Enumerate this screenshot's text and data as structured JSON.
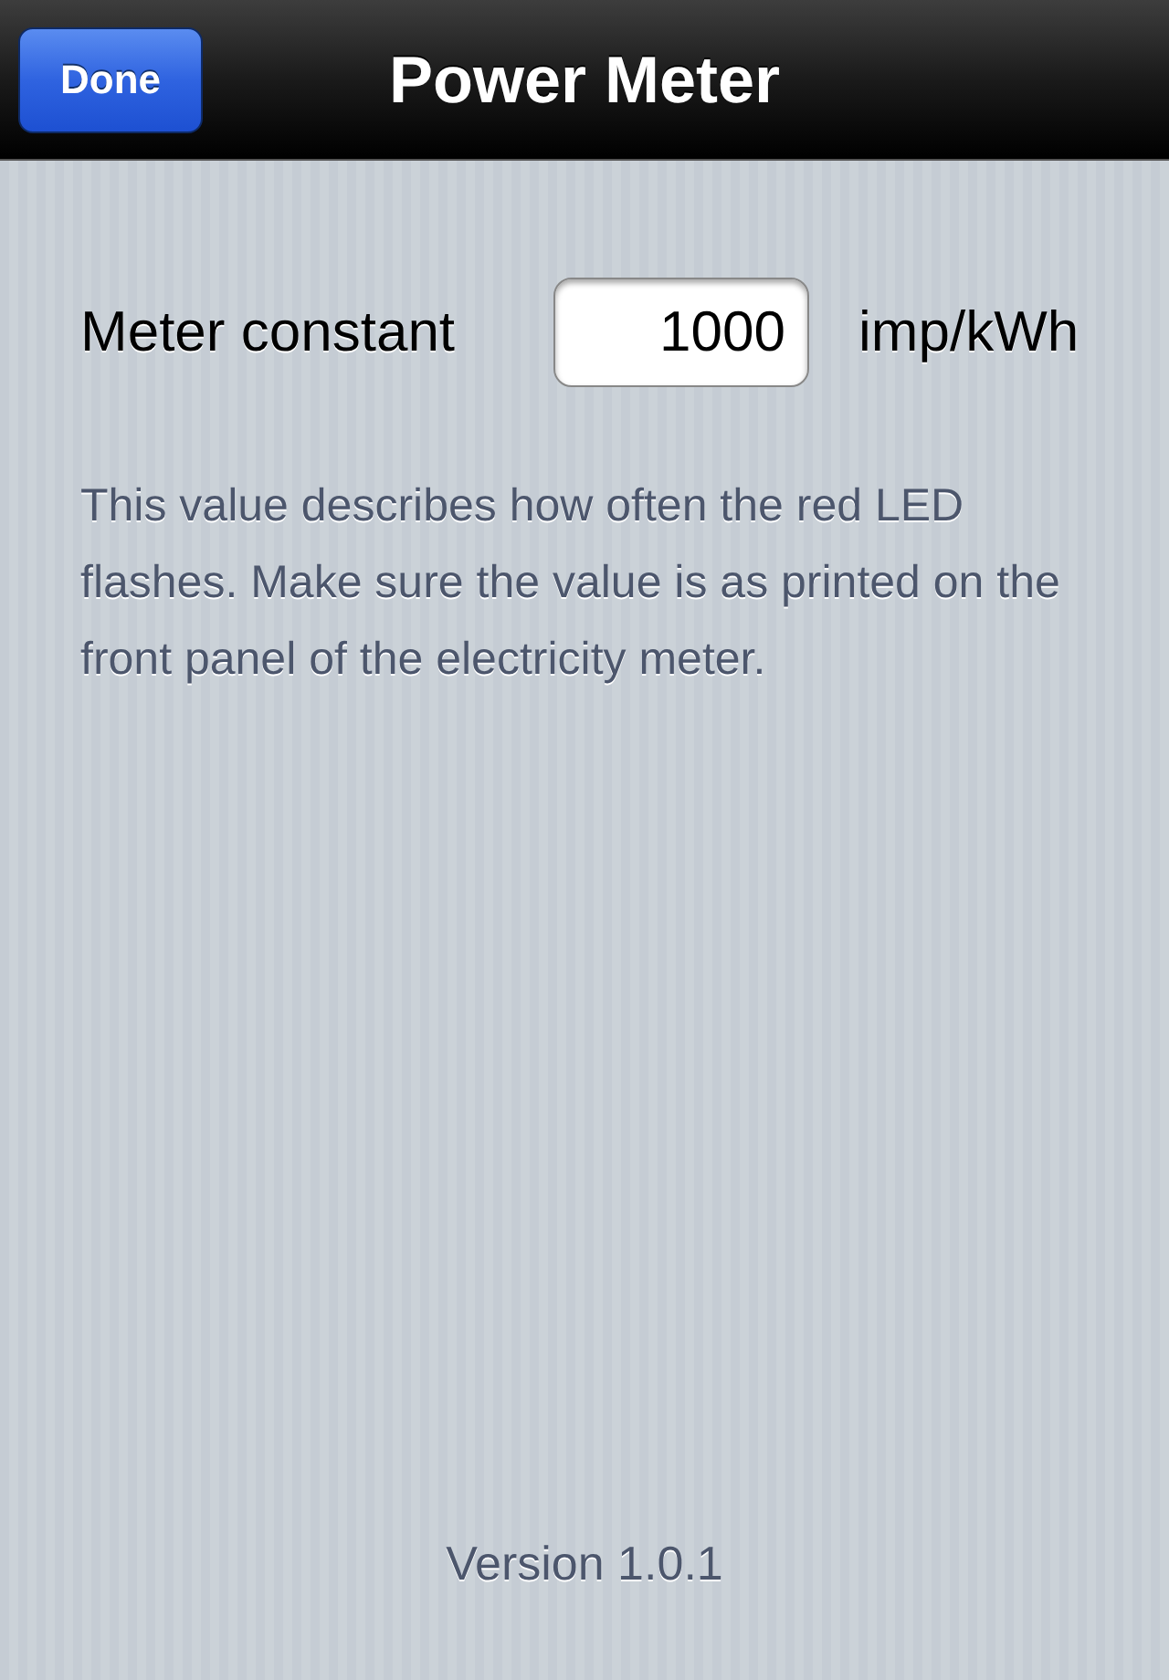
{
  "nav_bar": {
    "title": "Power Meter",
    "done_button": "Done"
  },
  "setting": {
    "label": "Meter constant",
    "value": "1000",
    "unit": "imp/kWh"
  },
  "description": "This value describes how often the red LED flashes.  Make sure the value is as printed on the front panel of the electricity meter.",
  "version": "Version 1.0.1"
}
